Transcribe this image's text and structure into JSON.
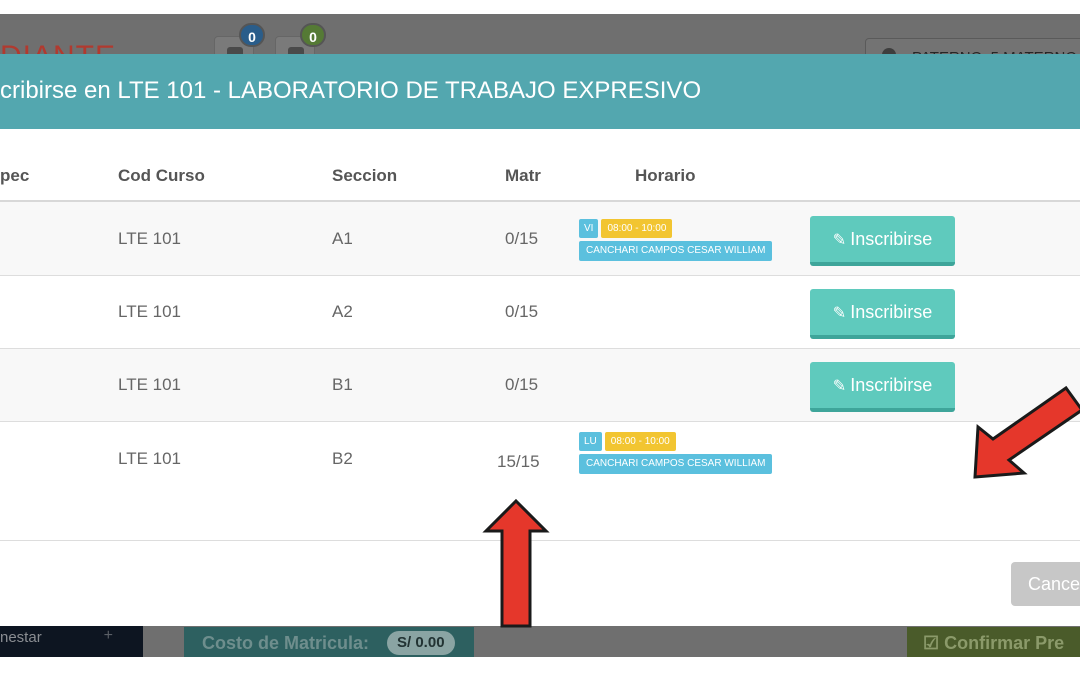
{
  "background": {
    "brand_fragment": "DIANTE",
    "notifications": [
      {
        "count": "0",
        "icon": "bell-icon"
      },
      {
        "count": "0",
        "icon": "inbox-icon"
      }
    ],
    "user_name": "PATERNO_5 MATERNO",
    "sidebar_item": "nestar",
    "sidebar_plus": "+",
    "cost_label": "Costo de Matricula:",
    "cost_amount": "S/ 0.00",
    "confirm_label": "☑ Confirmar Pre"
  },
  "modal": {
    "title": "cribirse en LTE 101 - LABORATORIO DE TRABAJO EXPRESIVO",
    "columns": {
      "espec": "pec",
      "cod_curso": "Cod Curso",
      "seccion": "Seccion",
      "matr": "Matr",
      "horario": "Horario"
    },
    "rows": [
      {
        "cod": "LTE 101",
        "seccion": "A1",
        "matr": "0/15",
        "schedule": {
          "day": "VI",
          "time": "08:00 - 10:00",
          "teacher": "CANCHARI CAMPOS CESAR WILLIAM"
        },
        "action": "Inscribirse"
      },
      {
        "cod": "LTE 101",
        "seccion": "A2",
        "matr": "0/15",
        "action": "Inscribirse"
      },
      {
        "cod": "LTE 101",
        "seccion": "B1",
        "matr": "0/15",
        "action": "Inscribirse"
      },
      {
        "cod": "LTE 101",
        "seccion": "B2",
        "matr": "15/15",
        "schedule": {
          "day": "LU",
          "time": "08:00 - 10:00",
          "teacher": "CANCHARI CAMPOS CESAR WILLIAM"
        }
      }
    ],
    "cancel_label": "Cancelar"
  },
  "colors": {
    "modal_header": "#53a7af",
    "inscribir_button": "#5fcabd",
    "annotation_arrow": "#e5372b"
  }
}
